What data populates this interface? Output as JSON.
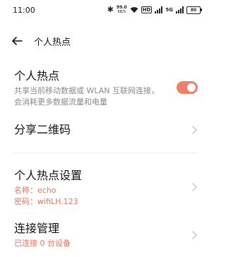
{
  "status_bar": {
    "time": "11:00",
    "network_speed_value": "99.0",
    "network_speed_unit": "KB/S",
    "hd_label": "HD",
    "g5_label": "5G",
    "battery_level": "80",
    "icons": [
      "bluetooth-icon",
      "wifi-icon",
      "signal-icon",
      "battery-icon"
    ]
  },
  "header": {
    "title": "个人热点"
  },
  "hotspot": {
    "title": "个人热点",
    "description_line1": "共享当前移动数据或 WLAN 互联网连接，",
    "description_line2": "会消耗更多数据流量和电量",
    "enabled": true,
    "toggle_color": "#f07e68"
  },
  "share_qr": {
    "title": "分享二维码"
  },
  "hotspot_settings": {
    "title": "个人热点设置",
    "name_line": "名称：echo",
    "password_line": "密码：wifiLH.123",
    "accent_color": "#e8765f"
  },
  "connection_management": {
    "title": "连接管理",
    "status": "已连接 0 台设备"
  }
}
